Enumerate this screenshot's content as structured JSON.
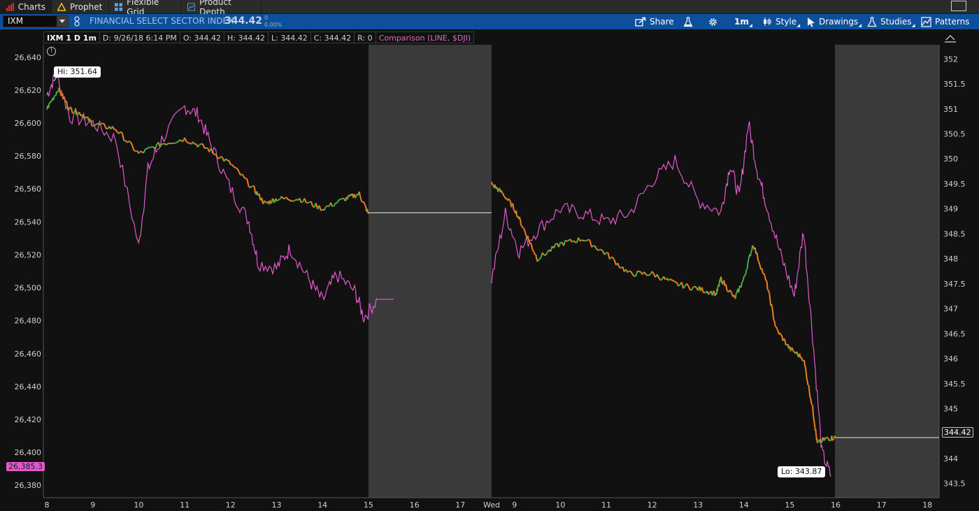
{
  "tabs": [
    {
      "label": "Charts",
      "icon": "bar-chart-icon",
      "active": true
    },
    {
      "label": "Prophet",
      "icon": "warning-triangle-icon",
      "active": false
    },
    {
      "label": "Flexible Grid",
      "icon": "grid-icon",
      "active": false
    },
    {
      "label": "Product Depth",
      "icon": "depth-chart-icon",
      "active": false
    }
  ],
  "toolbar": {
    "symbol": "IXM",
    "description": "FINANCIAL SELECT SECTOR INDEX",
    "last_price": "344.42",
    "change": "0",
    "change_pct": "0.00%",
    "buttons": {
      "share": "Share",
      "timeframe": "1m",
      "style": "Style",
      "drawings": "Drawings",
      "studies": "Studies",
      "patterns": "Patterns"
    },
    "accent_color": "#0d4f9b"
  },
  "infobar": {
    "title": "IXM 1 D 1m",
    "date": "D: 9/26/18 6:14 PM",
    "open": "O: 344.42",
    "high": "H: 344.42",
    "low": "L: 344.42",
    "close": "C: 344.42",
    "range": "R: 0",
    "comparison": "Comparison (LINE, $DJI)"
  },
  "chart_data": {
    "type": "line",
    "symbol": "IXM",
    "comparison_symbol": "$DJI",
    "left_axis": {
      "ticks": [
        "26,640",
        "26,620",
        "26,600",
        "26,580",
        "26,560",
        "26,540",
        "26,520",
        "26,500",
        "26,480",
        "26,460",
        "26,440",
        "26,420",
        "26,400",
        "26,380"
      ],
      "range": [
        26375,
        26645
      ]
    },
    "right_axis": {
      "ticks": [
        "352",
        "351.5",
        "351",
        "350.5",
        "350",
        "349.5",
        "349",
        "348.5",
        "348",
        "347.5",
        "347",
        "346.5",
        "346",
        "345.5",
        "345",
        "344.5",
        "344",
        "343.5"
      ],
      "range": [
        343.3,
        352.2
      ]
    },
    "x_ticks": [
      "8",
      "9",
      "10",
      "11",
      "12",
      "13",
      "14",
      "15",
      "16",
      "17",
      "Wed",
      "9",
      "10",
      "11",
      "12",
      "13",
      "14",
      "15",
      "16",
      "17",
      "18"
    ],
    "annotations": {
      "high": "Hi: 351.64",
      "low": "Lo: 343.87",
      "last_price_label": "344.42",
      "comparison_last_label": "26,385.3"
    },
    "series": [
      {
        "name": "IXM",
        "color_up": "#3fae49",
        "color_down": "#f07d1e",
        "points": [
          [
            8.0,
            351.0
          ],
          [
            8.25,
            351.4
          ],
          [
            8.5,
            351.0
          ],
          [
            8.75,
            350.9
          ],
          [
            9.0,
            350.7
          ],
          [
            9.5,
            350.6
          ],
          [
            10.0,
            350.1
          ],
          [
            10.5,
            350.3
          ],
          [
            11.0,
            350.4
          ],
          [
            11.5,
            350.2
          ],
          [
            12.0,
            349.9
          ],
          [
            12.5,
            349.4
          ],
          [
            12.75,
            349.1
          ],
          [
            13.0,
            349.2
          ],
          [
            13.5,
            349.2
          ],
          [
            14.0,
            349.0
          ],
          [
            14.5,
            349.2
          ],
          [
            14.8,
            349.3
          ],
          [
            15.0,
            348.9
          ],
          [
            24.0,
            349.5
          ],
          [
            24.25,
            349.3
          ],
          [
            24.5,
            349.0
          ],
          [
            24.75,
            348.5
          ],
          [
            25.0,
            348.0
          ],
          [
            25.5,
            348.3
          ],
          [
            26.0,
            348.4
          ],
          [
            26.5,
            348.1
          ],
          [
            27.0,
            347.7
          ],
          [
            27.5,
            347.7
          ],
          [
            28.0,
            347.5
          ],
          [
            28.5,
            347.4
          ],
          [
            28.9,
            347.3
          ],
          [
            29.0,
            347.6
          ],
          [
            29.3,
            347.2
          ],
          [
            29.5,
            347.6
          ],
          [
            29.7,
            348.3
          ],
          [
            30.0,
            347.5
          ],
          [
            30.2,
            346.6
          ],
          [
            30.5,
            346.2
          ],
          [
            30.8,
            346.0
          ],
          [
            31.0,
            345.0
          ],
          [
            31.1,
            344.3
          ],
          [
            31.3,
            344.4
          ],
          [
            31.5,
            344.42
          ]
        ]
      },
      {
        "name": "$DJI",
        "color": "#e35ad0",
        "points": [
          [
            8.0,
            26617
          ],
          [
            8.2,
            26630
          ],
          [
            8.5,
            26604
          ],
          [
            9.0,
            26600
          ],
          [
            9.5,
            26590
          ],
          [
            10.0,
            26525
          ],
          [
            10.2,
            26572
          ],
          [
            10.5,
            26590
          ],
          [
            11.0,
            26610
          ],
          [
            11.3,
            26605
          ],
          [
            11.6,
            26585
          ],
          [
            12.0,
            26560
          ],
          [
            12.4,
            26540
          ],
          [
            12.6,
            26515
          ],
          [
            13.0,
            26512
          ],
          [
            13.3,
            26524
          ],
          [
            13.7,
            26505
          ],
          [
            14.0,
            26492
          ],
          [
            14.3,
            26508
          ],
          [
            14.7,
            26498
          ],
          [
            14.9,
            26482
          ],
          [
            15.2,
            26493
          ],
          [
            24.0,
            26505
          ],
          [
            24.3,
            26545
          ],
          [
            24.6,
            26522
          ],
          [
            25.0,
            26535
          ],
          [
            25.5,
            26548
          ],
          [
            26.0,
            26545
          ],
          [
            26.5,
            26540
          ],
          [
            27.0,
            26545
          ],
          [
            27.5,
            26565
          ],
          [
            28.0,
            26577
          ],
          [
            28.5,
            26553
          ],
          [
            29.0,
            26546
          ],
          [
            29.2,
            26575
          ],
          [
            29.4,
            26555
          ],
          [
            29.6,
            26600
          ],
          [
            29.8,
            26570
          ],
          [
            30.0,
            26550
          ],
          [
            30.3,
            26520
          ],
          [
            30.6,
            26495
          ],
          [
            30.8,
            26535
          ],
          [
            31.0,
            26470
          ],
          [
            31.2,
            26400
          ],
          [
            31.4,
            26385.3
          ]
        ]
      }
    ],
    "session_shading": {
      "after_hours_color": "#3a3a3a",
      "regular_hours_color": "#111111"
    },
    "grid": false
  }
}
